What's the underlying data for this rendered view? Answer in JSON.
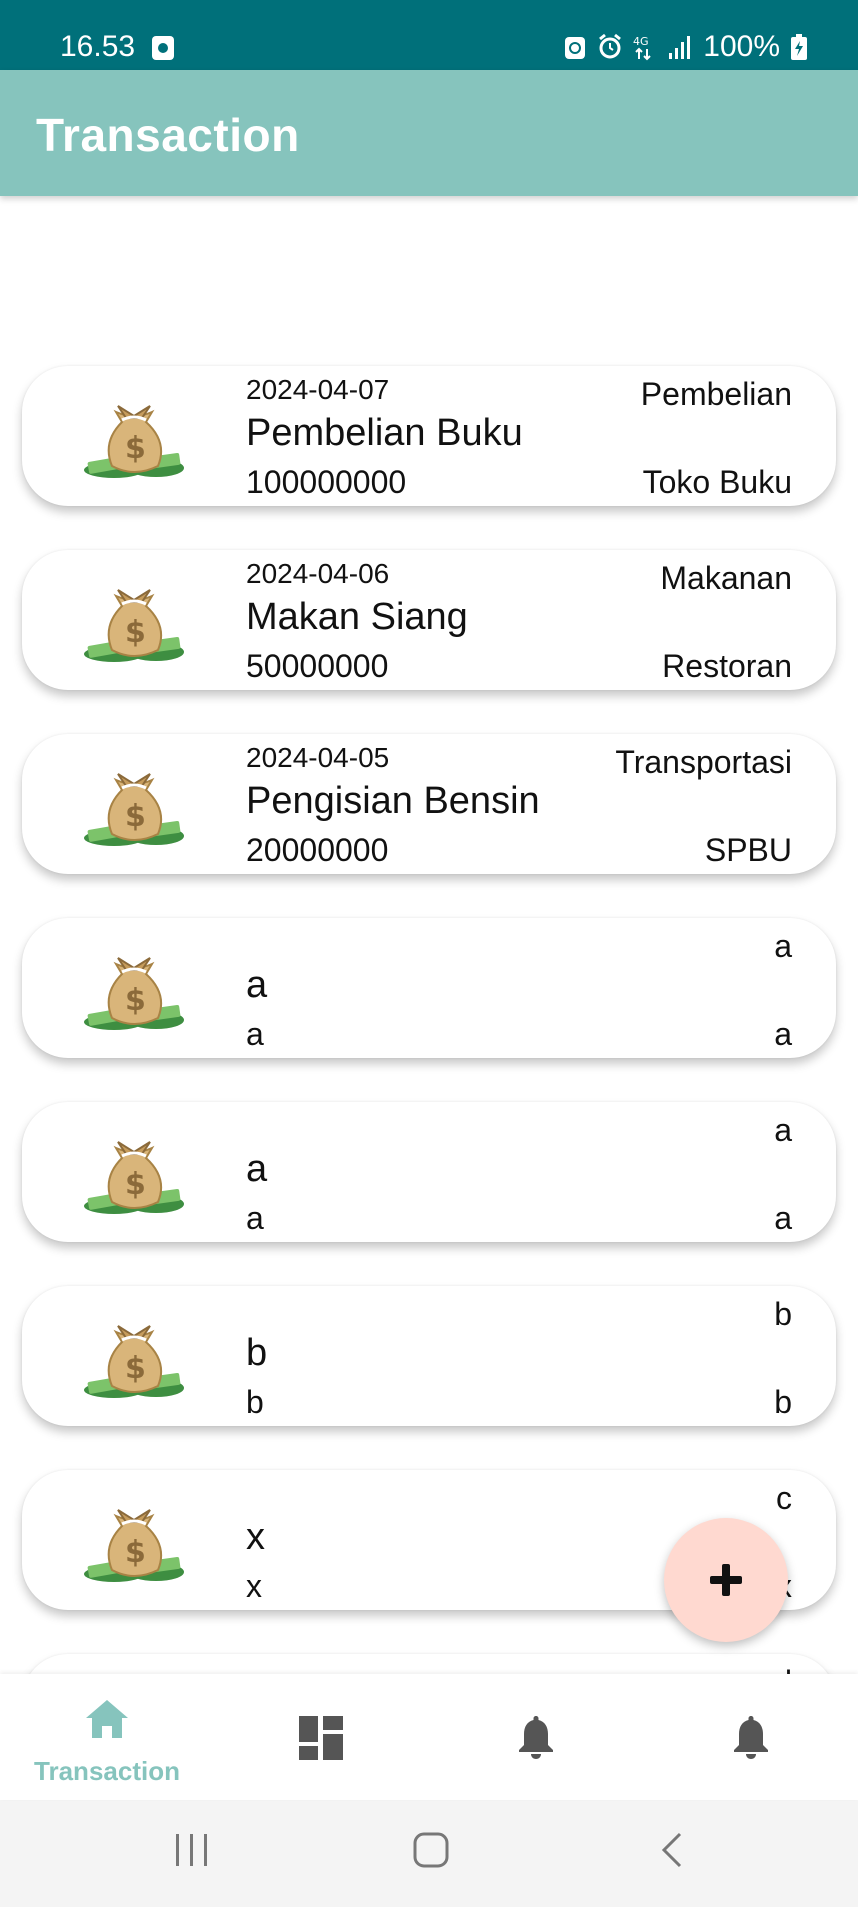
{
  "status_bar": {
    "time": "16.53",
    "network": "4G",
    "battery": "100%",
    "icons": [
      "gallery-icon",
      "alarm-icon",
      "signal-icon",
      "battery-charging-icon"
    ]
  },
  "app_bar": {
    "title": "Transaction"
  },
  "transactions": [
    {
      "date": "2024-04-07",
      "title": "Pembelian Buku",
      "amount": "100000000",
      "category": "Pembelian",
      "place": "Toko Buku"
    },
    {
      "date": "2024-04-06",
      "title": "Makan Siang",
      "amount": "50000000",
      "category": "Makanan",
      "place": "Restoran"
    },
    {
      "date": "2024-04-05",
      "title": "Pengisian Bensin",
      "amount": "20000000",
      "category": "Transportasi",
      "place": "SPBU"
    },
    {
      "date": "",
      "title": "a",
      "amount": "a",
      "category": "a",
      "place": "a"
    },
    {
      "date": "",
      "title": "a",
      "amount": "a",
      "category": "a",
      "place": "a"
    },
    {
      "date": "",
      "title": "b",
      "amount": "b",
      "category": "b",
      "place": "b"
    },
    {
      "date": "",
      "title": "x",
      "amount": "x",
      "category": "c",
      "place": "x"
    },
    {
      "date": "",
      "title": "",
      "amount": "",
      "category": "d",
      "place": ""
    }
  ],
  "fab": {
    "icon": "plus-icon"
  },
  "bottom_nav": {
    "items": [
      {
        "label": "Transaction",
        "icon": "home-icon",
        "active": true
      },
      {
        "label": "",
        "icon": "dashboard-icon",
        "active": false
      },
      {
        "label": "",
        "icon": "bell-icon",
        "active": false
      },
      {
        "label": "",
        "icon": "bell-icon",
        "active": false
      }
    ]
  },
  "colors": {
    "status_bar": "#00707a",
    "app_bar": "#86c4bd",
    "active_nav": "#86c4bd",
    "inactive_nav": "#555555",
    "fab": "#ffd9d0"
  }
}
